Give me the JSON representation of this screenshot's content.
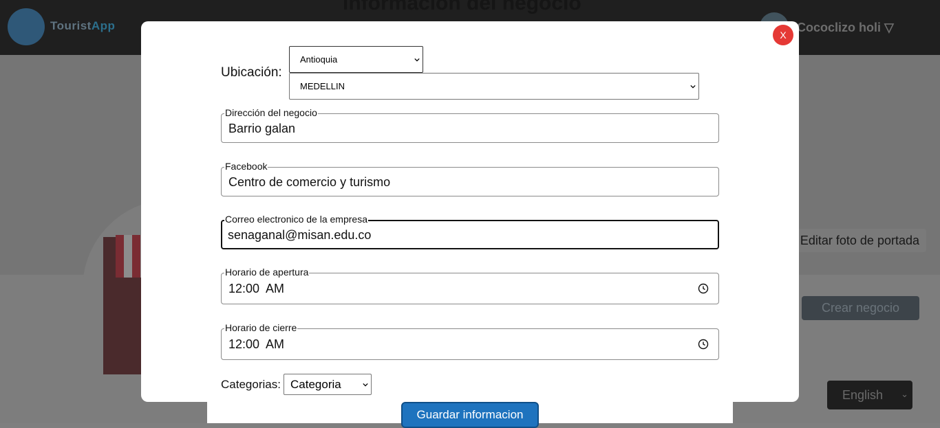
{
  "header": {
    "logo_text_main": "Tourist",
    "logo_text_accent": "App",
    "page_title": "Información del negocio",
    "user_name": "Cococlizo holi ▽"
  },
  "background": {
    "edit_cover_label": "Editar foto de portada",
    "create_business_label": "Crear negocio",
    "language_value": "English"
  },
  "modal": {
    "close_label": "X",
    "location": {
      "label": "Ubicación:",
      "department_value": "Antioquia",
      "city_value": "MEDELLIN"
    },
    "fields": [
      {
        "legend": "Dirección del negocio",
        "value": "Barrio galan"
      },
      {
        "legend": "Facebook",
        "value": "Centro de comercio y turismo"
      },
      {
        "legend": "Correo electronico de la empresa",
        "value": "senaganal@misan.edu.co"
      },
      {
        "legend": "Horario de apertura",
        "value": "12:00  AM"
      },
      {
        "legend": "Horario de cierre",
        "value": "12:00  AM"
      }
    ],
    "categories": {
      "label": "Categorias:",
      "selected": "Categoria"
    },
    "save_label": "Guardar informacion"
  },
  "colors": {
    "primary_button": "#1e73be",
    "close_button": "#e53935",
    "overlay": "#7f7f7f"
  }
}
